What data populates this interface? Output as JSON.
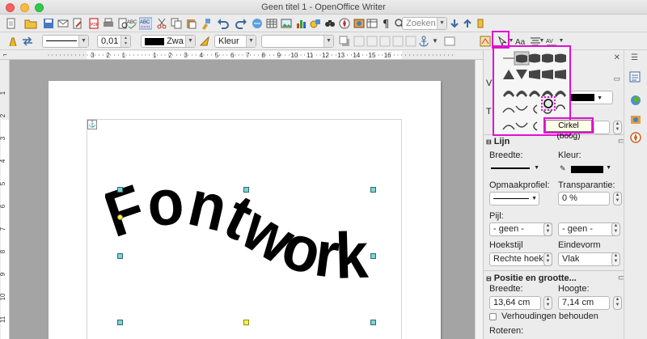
{
  "window": {
    "title": "Geen titel 1 - OpenOffice Writer"
  },
  "toolbar1": {
    "search_placeholder": "Zoeken"
  },
  "toolbar2": {
    "line_width": "0,01 \"",
    "line_color": "Zwa",
    "area_style": "Kleur",
    "area_fill": ""
  },
  "ruler": {
    "h_ticks": [
      "3",
      "2",
      "1",
      "1",
      "2",
      "3",
      "4",
      "5",
      "6",
      "7",
      "8",
      "9",
      "10",
      "11",
      "12",
      "13",
      "14",
      "15",
      "16"
    ],
    "v_ticks": [
      "1",
      "2",
      "3",
      "4",
      "5",
      "6",
      "7",
      "8",
      "9",
      "10",
      "11"
    ]
  },
  "document": {
    "fontwork_text": "Fontwork"
  },
  "fontwork_popup": {
    "tooltip": "Cirkel (boog)"
  },
  "sidebar": {
    "line_section": "Lijn",
    "width_label": "Breedte:",
    "color_label": "Kleur:",
    "style_label": "Opmaakprofiel:",
    "transparency_label": "Transparantie:",
    "transparency_value": "0 %",
    "arrow_label": "Pijl:",
    "arrow_start": "- geen -",
    "arrow_end": "- geen -",
    "corner_label": "Hoekstijl",
    "corner_value": "Rechte hoek",
    "cap_label": "Eindevorm",
    "cap_value": "Vlak",
    "position_section": "Positie en grootte...",
    "pos_width_label": "Breedte:",
    "pos_width_value": "13,64 cm",
    "pos_height_label": "Hoogte:",
    "pos_height_value": "7,14 cm",
    "keep_ratio": "Verhoudingen behouden",
    "rotate_label": "Roteren:",
    "area_color_stub": "",
    "area_label_v": "V",
    "area_label_t": "T"
  },
  "colors": {
    "highlight": "#e010d0",
    "handle": "#7fd3d0"
  }
}
